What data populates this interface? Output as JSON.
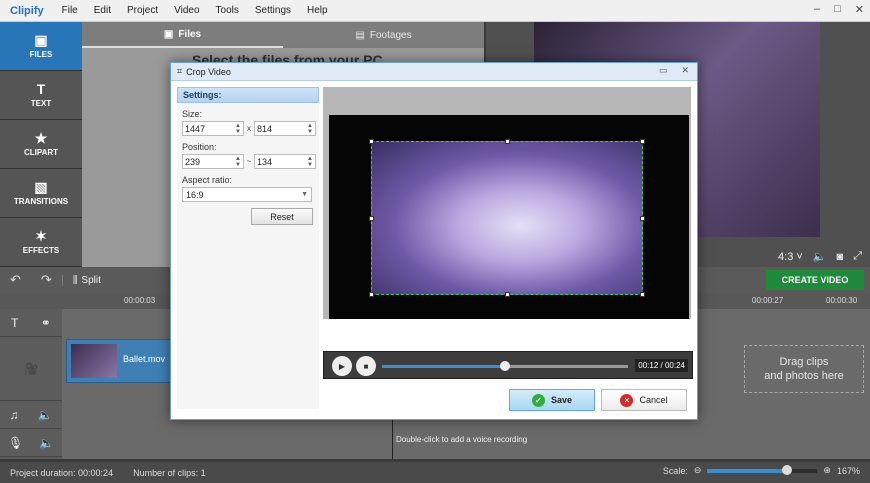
{
  "app": {
    "name": "Clipify",
    "menu": [
      "File",
      "Edit",
      "Project",
      "Video",
      "Tools",
      "Settings",
      "Help"
    ],
    "window_controls": [
      "–",
      "□",
      "✕"
    ]
  },
  "leftnav": {
    "items": [
      {
        "label": "FILES",
        "icon": "▣"
      },
      {
        "label": "TEXT",
        "icon": "T"
      },
      {
        "label": "CLIPART",
        "icon": "★"
      },
      {
        "label": "TRANSITIONS",
        "icon": "▧"
      },
      {
        "label": "EFFECTS",
        "icon": "✶"
      }
    ]
  },
  "tabs": {
    "files": "Files",
    "footages": "Footages",
    "headline": "Select the files from your PC"
  },
  "preview": {
    "ratio": "4:3 ˅"
  },
  "toolbar": {
    "split_label": "Split",
    "create_video": "CREATE VIDEO"
  },
  "ruler": {
    "ticks": [
      "00:00:03",
      "00:00:27",
      "00:00:30"
    ]
  },
  "timeline": {
    "clip_name": "Ballet.mov",
    "drag_hint_line1": "Drag clips",
    "drag_hint_line2": "and photos here",
    "voice_hint": "Double-click to add a voice recording"
  },
  "status": {
    "duration": "Project duration:  00:00:24",
    "clips": "Number of clips: 1",
    "scale_label": "Scale:",
    "zoom": "167%",
    "zoom_fraction": 0.72
  },
  "dialog": {
    "title": "Crop Video",
    "settings_header": "Settings:",
    "size_label": "Size:",
    "size_w": "1447",
    "size_h": "814",
    "size_sep": "x",
    "position_label": "Position:",
    "pos_x": "239",
    "pos_y": "134",
    "pos_sep": "~",
    "aspect_label": "Aspect ratio:",
    "aspect_value": "16:9",
    "reset_label": "Reset",
    "time": "00:12 / 00:24",
    "progress_fraction": 0.5,
    "save_label": "Save",
    "cancel_label": "Cancel"
  }
}
